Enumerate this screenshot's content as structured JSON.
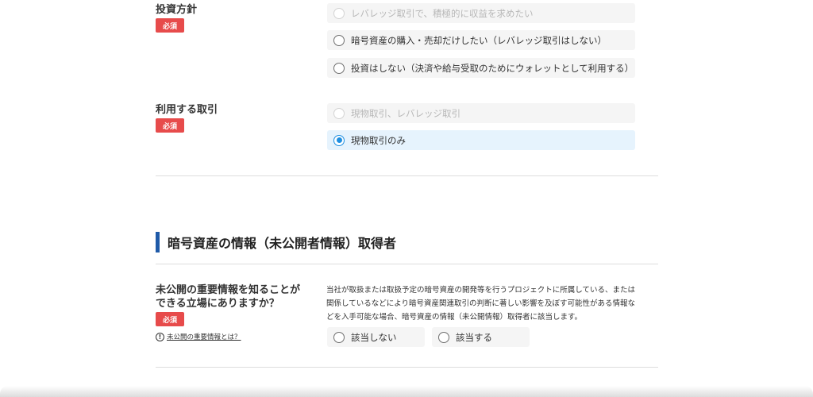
{
  "investment_policy": {
    "label": "投資方針",
    "required": "必須",
    "options": [
      "レバレッジ取引で、積極的に収益を求めたい",
      "暗号資産の購入・売却だけしたい（レバレッジ取引はしない）",
      "投資はしない（決済や給与受取のためにウォレットとして利用する）"
    ]
  },
  "trade_type": {
    "label": "利用する取引",
    "required": "必須",
    "options": [
      "現物取引、レバレッジ取引",
      "現物取引のみ"
    ]
  },
  "section": {
    "title": "暗号資産の情報（未公開者情報）取得者"
  },
  "insider": {
    "label_line1": "未公開の重要情報を知ることが",
    "label_line2": "できる立場にありますか？",
    "required": "必須",
    "help_icon": "!",
    "help_link": "未公開の重要情報とは？",
    "description_line1": "当社が取扱または取扱予定の暗号資産の開発等を行うプロジェクトに所属している、または",
    "description_line2": "関係しているなどにより暗号資産関連取引の判断に著しい影響を及ぼす可能性がある情報な",
    "description_line3": "どを入手可能な場合、暗号資産の情報（未公開情報）取得者に該当します。",
    "options": [
      "該当しない",
      "該当する"
    ]
  },
  "colors": {
    "required_badge": "#e74b4b",
    "section_accent": "#1f5aa8",
    "radio_selected": "#1e8fe1",
    "selected_background": "#e6f3fd"
  }
}
